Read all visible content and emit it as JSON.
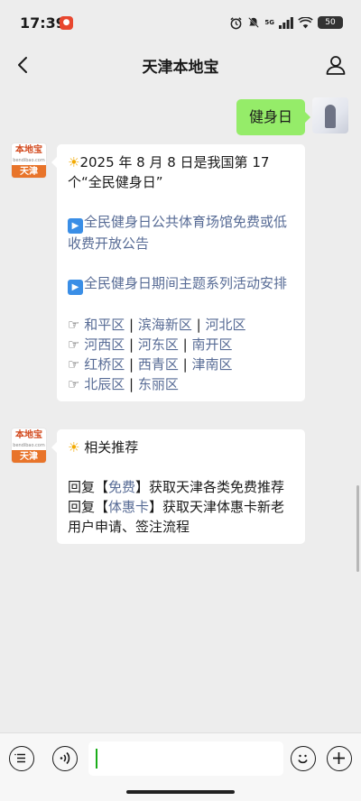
{
  "status": {
    "time": "17:39",
    "app_badge": "●",
    "network": "5G",
    "battery": "50"
  },
  "header": {
    "title": "天津本地宝"
  },
  "messages": {
    "outgoing": {
      "text": "健身日"
    },
    "bot": {
      "logo_text": "本地宝",
      "logo_domain": "bendibao.com",
      "logo_city": "天津"
    },
    "reply1": {
      "intro_emoji": "☀",
      "intro": "2025 年 8 月 8 日是我国第 17 个“全民健身日”",
      "link1": "全民健身日公共体育场馆免费或低收费开放公告",
      "link2": "全民健身日期间主题系列活动安排",
      "hand": "☞",
      "districts": [
        [
          "和平区",
          "滨海新区",
          "河北区"
        ],
        [
          "河西区",
          "河东区",
          "南开区"
        ],
        [
          "红桥区",
          "西青区",
          "津南区"
        ],
        [
          "北辰区",
          "东丽区"
        ]
      ]
    },
    "reply2": {
      "title_emoji": "☀",
      "title": "相关推荐",
      "line1_prefix": "回复【",
      "line1_keyword": "免费",
      "line1_suffix": "】获取天津各类免费推荐",
      "line2_prefix": "回复【",
      "line2_keyword": "体惠卡",
      "line2_suffix": "】获取天津体惠卡新老用户申请、签注流程"
    }
  },
  "input": {
    "value": ""
  },
  "colors": {
    "accent_green": "#95ec69",
    "link": "#576b95",
    "brand_orange": "#e8742a"
  }
}
